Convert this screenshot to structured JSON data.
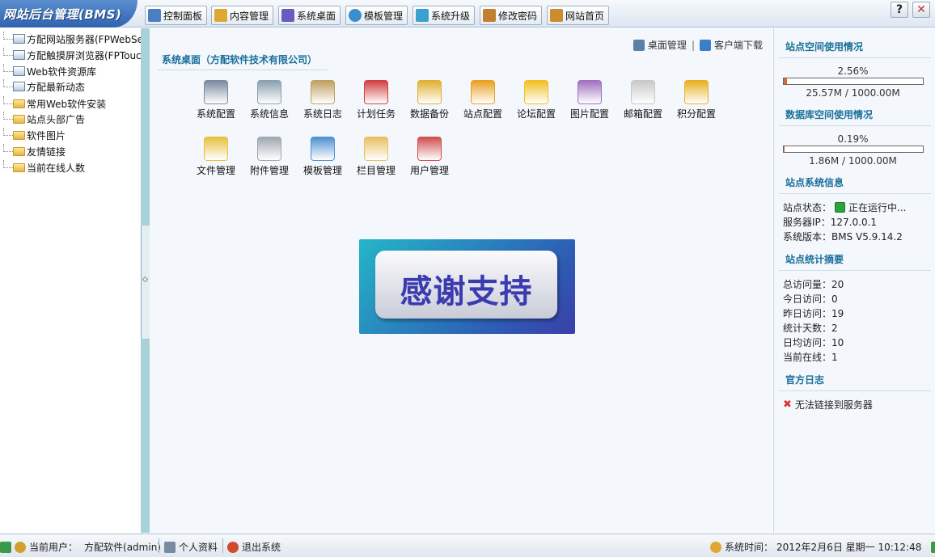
{
  "brand": "网站后台管理(BMS)",
  "nav": [
    {
      "label": "控制面板",
      "icon": "monitor-icon",
      "color": "#4a7fc0"
    },
    {
      "label": "内容管理",
      "icon": "documents-icon",
      "color": "#e0a830"
    },
    {
      "label": "系统桌面",
      "icon": "desktop-icon",
      "color": "#6a5bc0"
    },
    {
      "label": "模板管理",
      "icon": "template-icon",
      "color": "#3a8ed0"
    },
    {
      "label": "系统升级",
      "icon": "upgrade-icon",
      "color": "#3aa0d0"
    },
    {
      "label": "修改密码",
      "icon": "key-icon",
      "color": "#c08030"
    },
    {
      "label": "网站首页",
      "icon": "home-icon",
      "color": "#d08a30"
    }
  ],
  "window": {
    "help": "?",
    "close": "✕"
  },
  "tree": [
    {
      "label": "方配网站服务器(FPWebServer)",
      "type": "page"
    },
    {
      "label": "方配触摸屏浏览器(FPTouch)",
      "type": "page"
    },
    {
      "label": "Web软件资源库",
      "type": "page"
    },
    {
      "label": "方配最新动态",
      "type": "page"
    },
    {
      "label": "常用Web软件安装",
      "type": "folder"
    },
    {
      "label": "站点头部广告",
      "type": "folder"
    },
    {
      "label": "软件图片",
      "type": "folder"
    },
    {
      "label": "友情链接",
      "type": "folder"
    },
    {
      "label": "当前在线人数",
      "type": "folder"
    }
  ],
  "main": {
    "title": "系统桌面（方配软件技术有限公司）",
    "links": {
      "desktop": "桌面管理",
      "sep": "|",
      "client": "客户端下载"
    },
    "apps": [
      {
        "label": "系统配置",
        "icon": "computer-config-icon",
        "color": "#7a8aa0"
      },
      {
        "label": "系统信息",
        "icon": "system-info-icon",
        "color": "#8aa0b0"
      },
      {
        "label": "系统日志",
        "icon": "log-icon",
        "color": "#c0a060"
      },
      {
        "label": "计划任务",
        "icon": "calendar-icon",
        "color": "#d04040"
      },
      {
        "label": "数据备份",
        "icon": "database-icon",
        "color": "#e0b030"
      },
      {
        "label": "站点配置",
        "icon": "home-icon",
        "color": "#e8a020"
      },
      {
        "label": "论坛配置",
        "icon": "chat-icon",
        "color": "#f0c020"
      },
      {
        "label": "图片配置",
        "icon": "picture-icon",
        "color": "#a070c0"
      },
      {
        "label": "邮箱配置",
        "icon": "mail-icon",
        "color": "#c8c8c8"
      },
      {
        "label": "积分配置",
        "icon": "coins-icon",
        "color": "#e8b020"
      },
      {
        "label": "文件管理",
        "icon": "folder-globe-icon",
        "color": "#e8c040"
      },
      {
        "label": "附件管理",
        "icon": "paperclip-icon",
        "color": "#a0a8b0"
      },
      {
        "label": "模板管理",
        "icon": "template-icon",
        "color": "#5090d0"
      },
      {
        "label": "栏目管理",
        "icon": "folder-db-icon",
        "color": "#e8c060"
      },
      {
        "label": "用户管理",
        "icon": "users-icon",
        "color": "#d05050"
      }
    ],
    "banner": "感谢支持"
  },
  "right": {
    "space_title": "站点空间使用情况",
    "space_percent": "2.56%",
    "space_fraction": 0.0256,
    "space_usage": "25.57M / 1000.00M",
    "db_title": "数据库空间使用情况",
    "db_percent": "0.19%",
    "db_fraction": 0.0019,
    "db_usage": "1.86M / 1000.00M",
    "sysinfo_title": "站点系统信息",
    "status_label": "站点状态：",
    "status_value": "正在运行中...",
    "ip_line": "服务器IP：127.0.0.1",
    "version_line": "系统版本：BMS V5.9.14.2",
    "stats_title": "站点统计摘要",
    "stats": [
      "总访问量：20",
      "今日访问：0",
      "昨日访问：19",
      "统计天数：2",
      "日均访问：10",
      "当前在线：1"
    ],
    "log_title": "官方日志",
    "log_msg": "无法链接到服务器"
  },
  "status": {
    "user_label": "当前用户：",
    "user_value": "方配软件(admin)",
    "profile": "个人资料",
    "logout": "退出系统",
    "time_label": "系统时间：",
    "time_value": "2012年2月6日 星期一 10:12:48"
  }
}
